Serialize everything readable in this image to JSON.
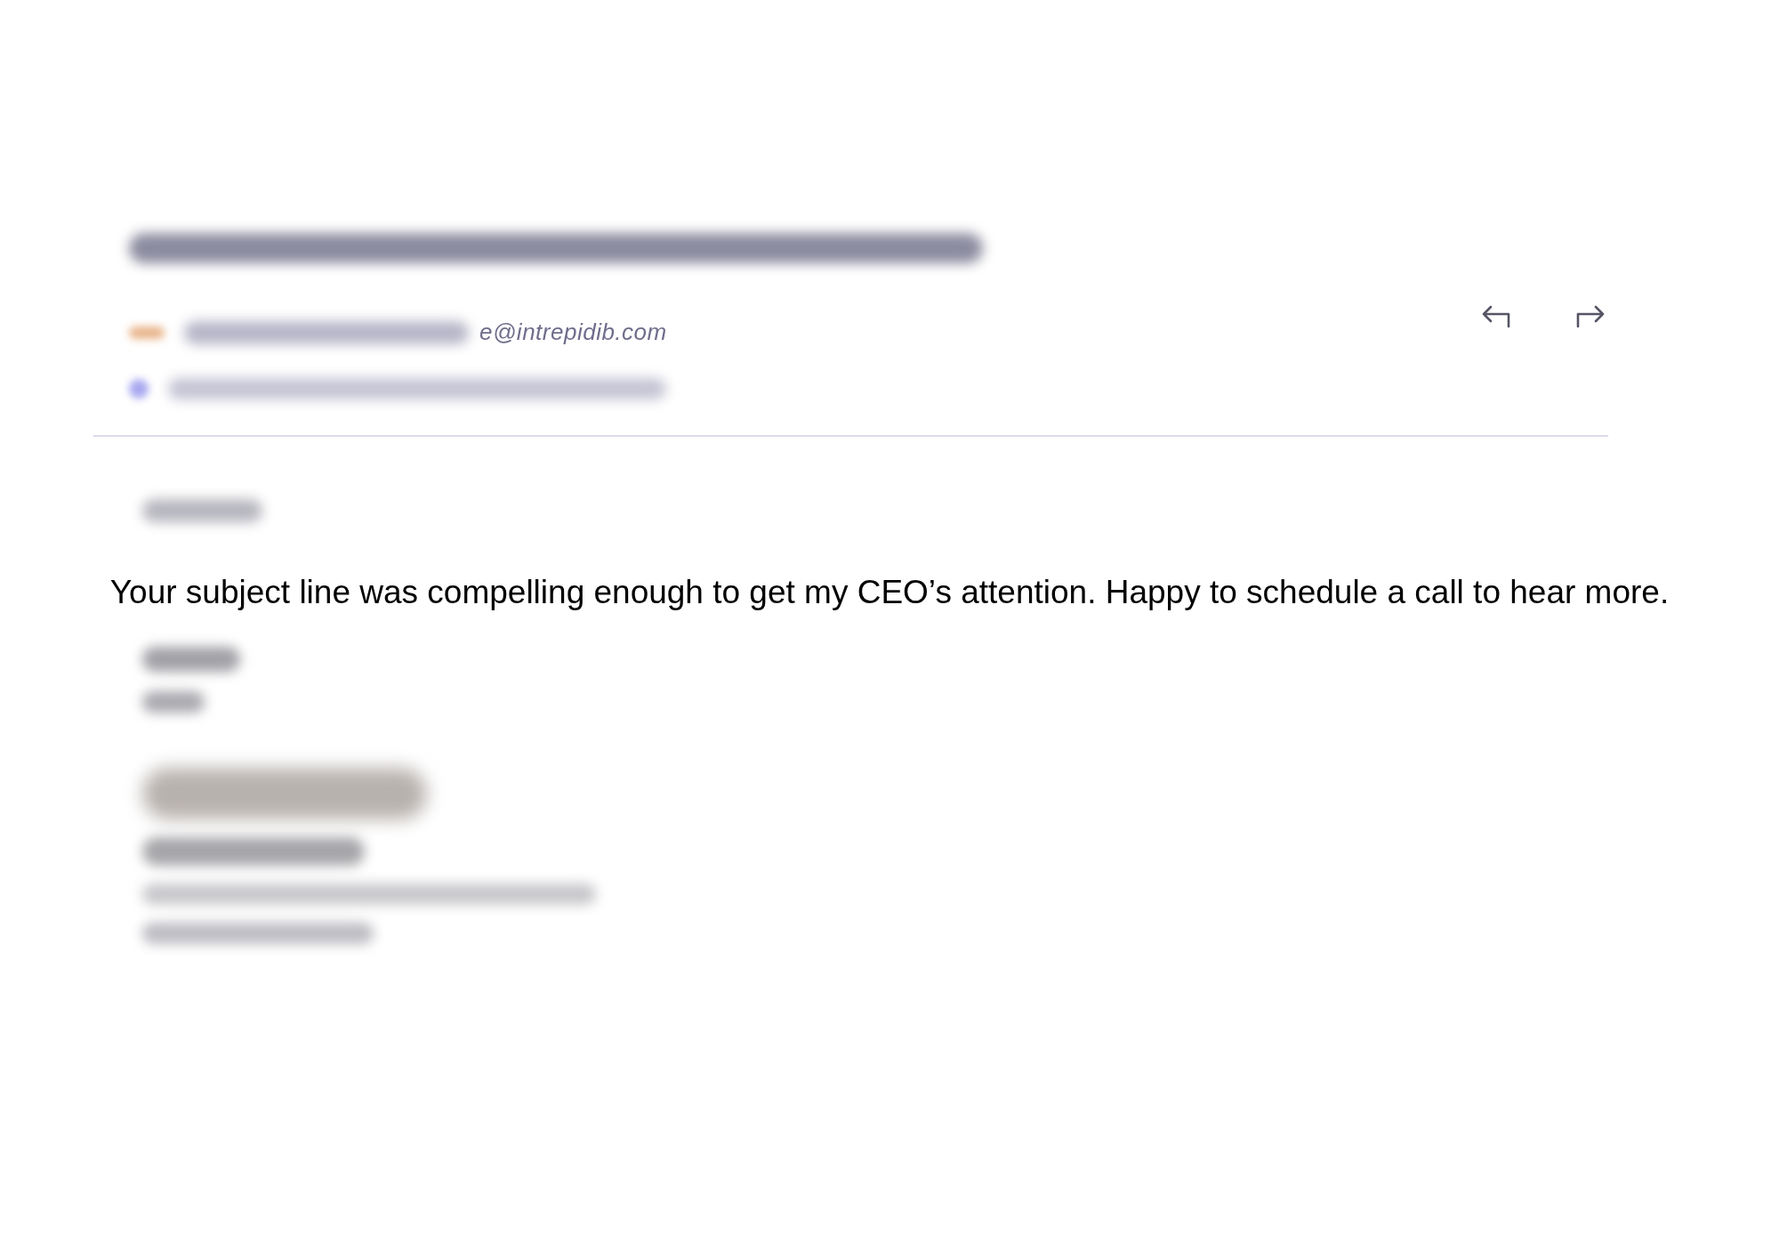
{
  "email": {
    "sender_address_visible": "e@intrepidib.com",
    "actions": [
      {
        "kind": "reply"
      },
      {
        "kind": "forward"
      }
    ],
    "body_line": "Your subject line was compelling enough to get my CEO’s attention. Happy to schedule a call to hear more."
  }
}
